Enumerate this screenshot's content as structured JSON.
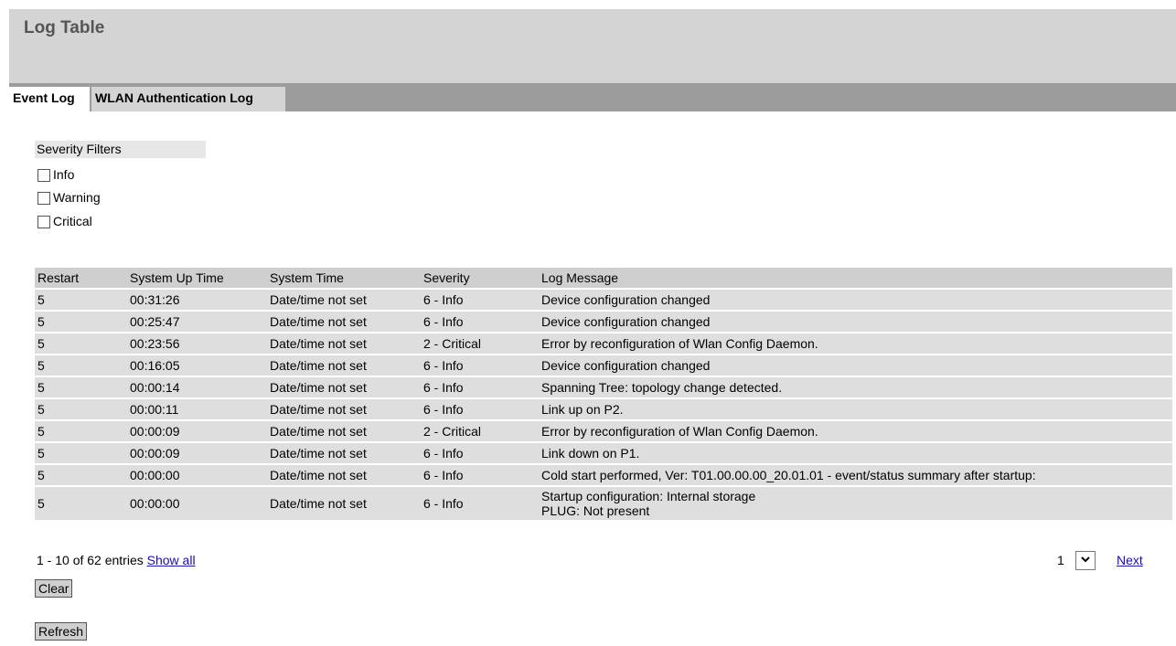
{
  "page": {
    "title": "Log Table"
  },
  "tabs": [
    {
      "label": "Event Log",
      "active": true
    },
    {
      "label": "WLAN Authentication Log",
      "active": false
    }
  ],
  "filters": {
    "heading": "Severity Filters",
    "options": [
      {
        "label": "Info",
        "checked": false
      },
      {
        "label": "Warning",
        "checked": false
      },
      {
        "label": "Critical",
        "checked": false
      }
    ]
  },
  "table": {
    "columns": [
      "Restart",
      "System Up Time",
      "System Time",
      "Severity",
      "Log Message"
    ],
    "rows": [
      [
        "5",
        "00:31:26",
        "Date/time not set",
        "6 - Info",
        "Device configuration changed"
      ],
      [
        "5",
        "00:25:47",
        "Date/time not set",
        "6 - Info",
        "Device configuration changed"
      ],
      [
        "5",
        "00:23:56",
        "Date/time not set",
        "2 - Critical",
        "Error by reconfiguration of Wlan Config Daemon."
      ],
      [
        "5",
        "00:16:05",
        "Date/time not set",
        "6 - Info",
        "Device configuration changed"
      ],
      [
        "5",
        "00:00:14",
        "Date/time not set",
        "6 - Info",
        "Spanning Tree: topology change detected."
      ],
      [
        "5",
        "00:00:11",
        "Date/time not set",
        "6 - Info",
        "Link up on P2."
      ],
      [
        "5",
        "00:00:09",
        "Date/time not set",
        "2 - Critical",
        "Error by reconfiguration of Wlan Config Daemon."
      ],
      [
        "5",
        "00:00:09",
        "Date/time not set",
        "6 - Info",
        "Link down on P1."
      ],
      [
        "5",
        "00:00:00",
        "Date/time not set",
        "6 - Info",
        "Cold start performed, Ver: T01.00.00.00_20.01.01 - event/status summary after startup:"
      ],
      [
        "5",
        "00:00:00",
        "Date/time not set",
        "6 - Info",
        "Startup configuration: Internal storage\nPLUG: Not present"
      ]
    ]
  },
  "pagination": {
    "summary": "1 - 10 of 62 entries",
    "show_all_label": "Show all",
    "page_value": "1",
    "next_label": "Next"
  },
  "buttons": {
    "clear_label": "Clear",
    "refresh_label": "Refresh"
  },
  "icons": {
    "dropdown": "chevron-down-icon",
    "checkbox": "checkbox-icon"
  }
}
